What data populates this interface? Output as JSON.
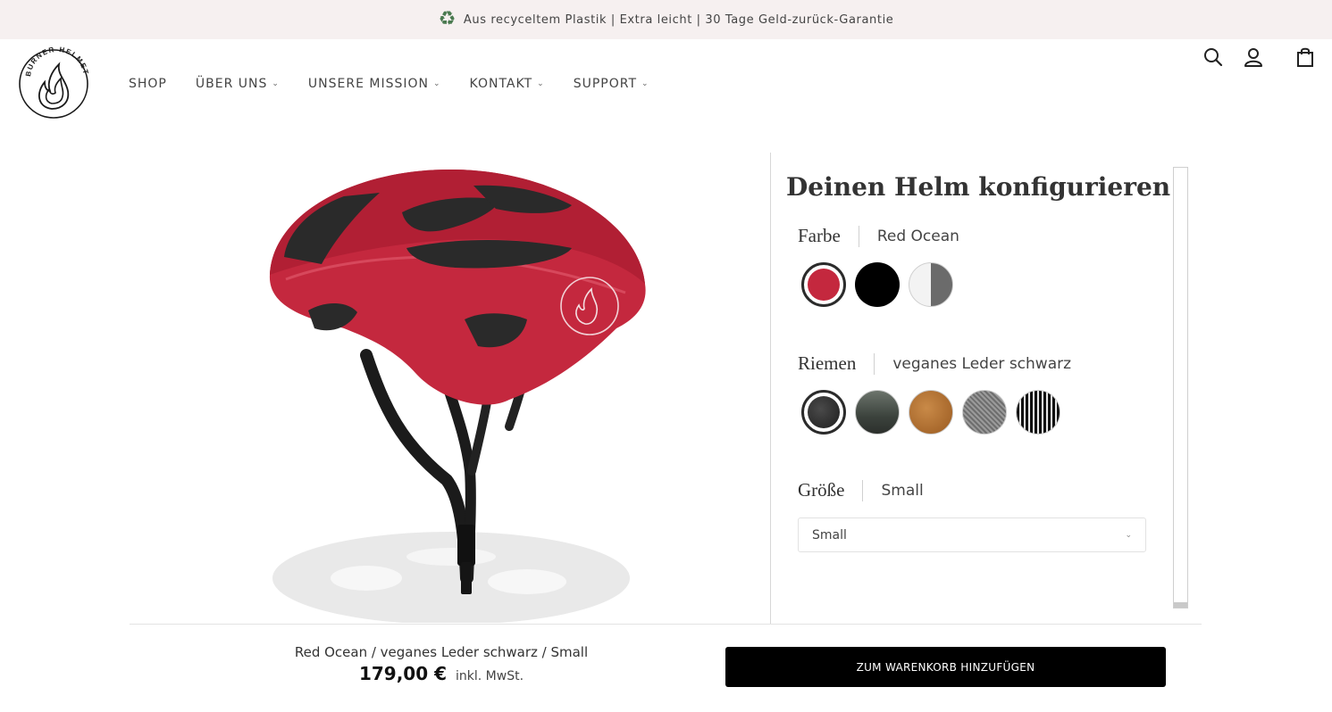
{
  "announcement": {
    "icon": "recycle-icon",
    "text": "Aus recyceltem Plastik | Extra leicht | 30 Tage Geld-zurück-Garantie"
  },
  "brand": {
    "logo_text": "BURNER HELMET"
  },
  "nav": {
    "items": [
      {
        "label": "SHOP",
        "has_dropdown": false
      },
      {
        "label": "ÜBER UNS",
        "has_dropdown": true
      },
      {
        "label": "UNSERE MISSION",
        "has_dropdown": true
      },
      {
        "label": "KONTAKT",
        "has_dropdown": true
      },
      {
        "label": "SUPPORT",
        "has_dropdown": true
      }
    ]
  },
  "header_icons": [
    "search-icon",
    "account-icon",
    "cart-bag-icon"
  ],
  "product": {
    "image_alt": "red-bicycle-helmet-image",
    "helmet_color": "#c4283e"
  },
  "configurator": {
    "title": "Deinen Helm konfigurieren",
    "color": {
      "label": "Farbe",
      "selected": "Red Ocean",
      "swatches": [
        {
          "name": "red-ocean",
          "selected": true,
          "color": "#c4283e"
        },
        {
          "name": "black",
          "selected": false,
          "color": "#000000"
        },
        {
          "name": "white-grey",
          "selected": false,
          "color": "#6b6b6b"
        }
      ]
    },
    "strap": {
      "label": "Riemen",
      "selected": "veganes Leder schwarz",
      "swatches": [
        {
          "name": "vegan-leather-black",
          "selected": true,
          "color": "#2a2a2a"
        },
        {
          "name": "dark-green-grey",
          "selected": false,
          "color": "#4a524b"
        },
        {
          "name": "cognac-leather",
          "selected": false,
          "color": "#b06a2a"
        },
        {
          "name": "grey-mesh",
          "selected": false,
          "color": "#8c8c8c"
        },
        {
          "name": "black-white-pattern",
          "selected": false,
          "color": "#1a1a1a"
        }
      ]
    },
    "size": {
      "label": "Größe",
      "selected": "Small",
      "select_value": "Small"
    }
  },
  "footer_bar": {
    "variant_summary": "Red Ocean / veganes Leder schwarz / Small",
    "price": "179,00 €",
    "tax_note": "inkl. MwSt.",
    "cart_button": "ZUM WARENKORB HINZUFÜGEN"
  }
}
